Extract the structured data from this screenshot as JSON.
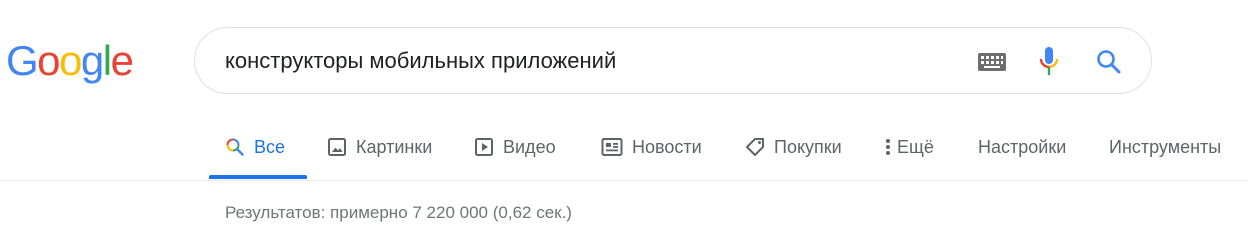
{
  "logo": {
    "letters": [
      {
        "char": "G",
        "color": "#4285F4"
      },
      {
        "char": "o",
        "color": "#EA4335"
      },
      {
        "char": "o",
        "color": "#FBBC05"
      },
      {
        "char": "g",
        "color": "#4285F4"
      },
      {
        "char": "l",
        "color": "#34A853"
      },
      {
        "char": "e",
        "color": "#EA4335"
      }
    ]
  },
  "search": {
    "value": "конструкторы мобильных приложений",
    "icons": [
      "keyboard-icon",
      "microphone-icon",
      "search-icon"
    ]
  },
  "tabs": [
    {
      "label": "Все",
      "icon": "search-icon",
      "active": true
    },
    {
      "label": "Картинки",
      "icon": "image-icon",
      "active": false
    },
    {
      "label": "Видео",
      "icon": "play-icon",
      "active": false
    },
    {
      "label": "Новости",
      "icon": "newspaper-icon",
      "active": false
    },
    {
      "label": "Покупки",
      "icon": "tag-icon",
      "active": false
    },
    {
      "label": "Ещё",
      "icon": "more-vert-icon",
      "active": false
    },
    {
      "label": "Настройки",
      "active": false
    },
    {
      "label": "Инструменты",
      "active": false
    }
  ],
  "results_stats": "Результатов: примерно 7 220 000 (0,62 сек.)",
  "colors": {
    "accent": "#1a73e8",
    "tab_text": "#5f6368",
    "stats_text": "#70757a"
  }
}
